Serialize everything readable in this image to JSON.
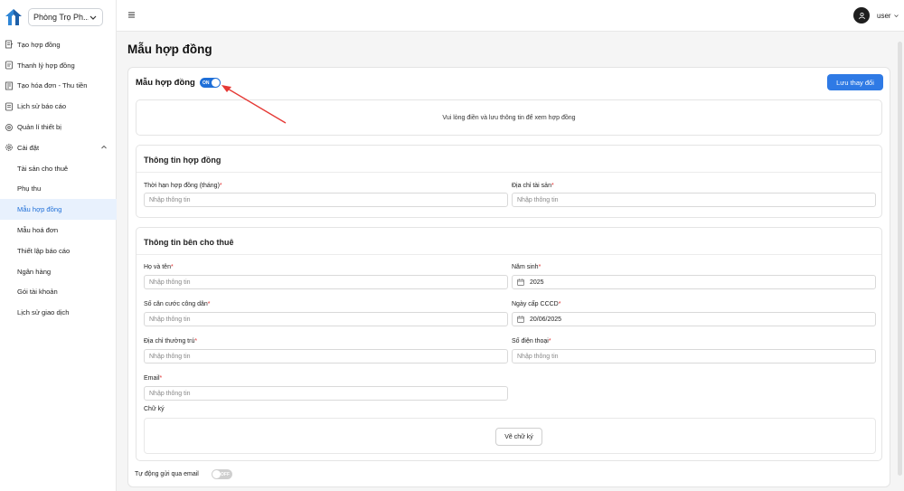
{
  "sidebar": {
    "property_select": "Phòng Trọ Ph...",
    "items": [
      {
        "label": "Tạo hợp đồng",
        "icon": "contract-icon"
      },
      {
        "label": "Thanh lý hợp đồng",
        "icon": "terminate-icon"
      },
      {
        "label": "Tạo hóa đơn - Thu tiền",
        "icon": "invoice-icon"
      },
      {
        "label": "Lịch sử báo cáo",
        "icon": "history-icon"
      },
      {
        "label": "Quản lí thiết bị",
        "icon": "device-icon"
      },
      {
        "label": "Cài đặt",
        "icon": "gear-icon"
      }
    ],
    "settings_items": [
      {
        "label": "Tài sản cho thuê"
      },
      {
        "label": "Phụ thu"
      },
      {
        "label": "Mẫu hợp đồng",
        "active": true
      },
      {
        "label": "Mẫu hoá đơn"
      },
      {
        "label": "Thiết lập báo cáo"
      },
      {
        "label": "Ngân hàng"
      },
      {
        "label": "Gói tài khoản"
      },
      {
        "label": "Lịch sử giao dịch"
      }
    ]
  },
  "topbar": {
    "user": "user"
  },
  "page": {
    "title": "Mẫu hợp đồng"
  },
  "card": {
    "title": "Mẫu hợp đồng",
    "toggle_on_label": "ON",
    "save_label": "Lưu thay đổi",
    "preview_message": "Vui lòng điền và lưu thông tin để xem hợp đồng"
  },
  "contract_info": {
    "title": "Thông tin hợp đồng",
    "duration_label": "Thời hạn hợp đồng (tháng)",
    "duration_placeholder": "Nhập thông tin",
    "address_label": "Địa chỉ tài sản",
    "address_placeholder": "Nhập thông tin"
  },
  "landlord_info": {
    "title": "Thông tin bên cho thuê",
    "fullname_label": "Họ và tên",
    "fullname_placeholder": "Nhập thông tin",
    "birthyear_label": "Năm sinh",
    "birthyear_value": "2025",
    "idcard_label": "Số căn cước công dân",
    "idcard_placeholder": "Nhập thông tin",
    "issue_date_label": "Ngày cấp CCCD",
    "issue_date_value": "20/06/2025",
    "residence_label": "Địa chỉ thường trú",
    "residence_placeholder": "Nhập thông tin",
    "phone_label": "Số điện thoại",
    "phone_placeholder": "Nhập thông tin",
    "email_label": "Email",
    "email_placeholder": "Nhập thông tin",
    "signature_label": "Chữ ký",
    "signature_button": "Vẽ chữ ký",
    "required_mark": "*"
  },
  "auto_email": {
    "label": "Tự động gửi qua email",
    "toggle_label": "OFF"
  },
  "colors": {
    "primary": "#2f7ae5",
    "active_bg": "#e8f1fd",
    "required": "#e03131",
    "arrow": "#e53935"
  }
}
